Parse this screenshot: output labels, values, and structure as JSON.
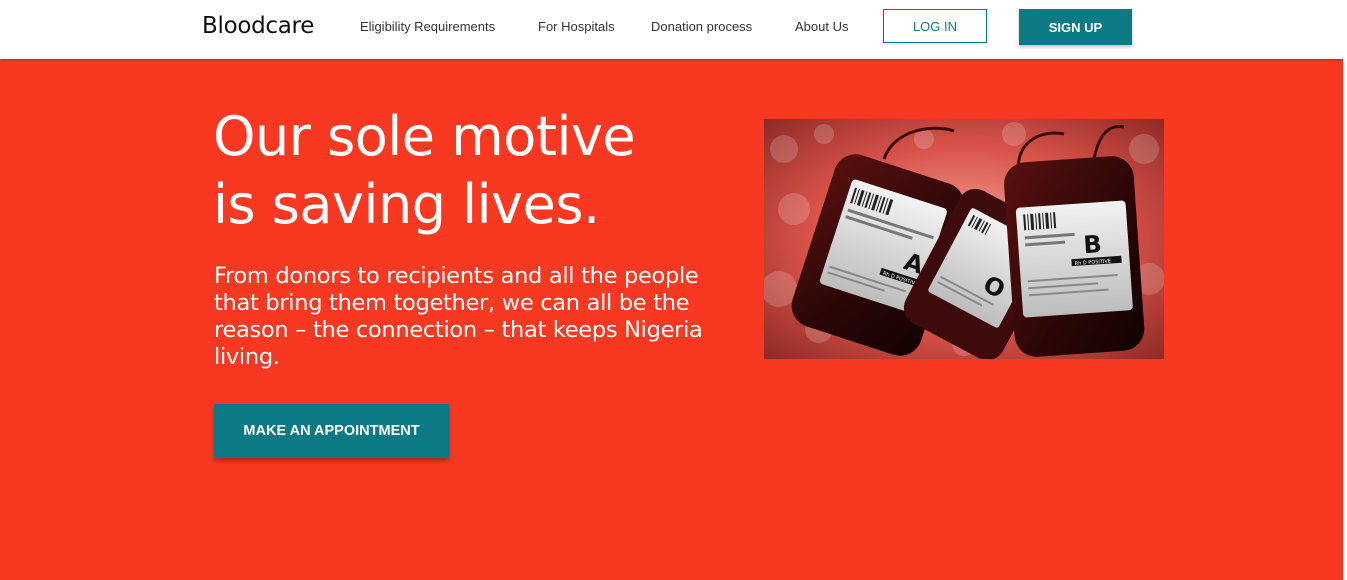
{
  "nav": {
    "logo": "Bloodcare",
    "links": [
      {
        "label": "Eligibility Requirements"
      },
      {
        "label": "For Hospitals"
      },
      {
        "label": "Donation process"
      },
      {
        "label": "About Us"
      }
    ],
    "login_label": "LOG IN",
    "signup_label": "SIGN UP"
  },
  "hero": {
    "headline_line1": "Our sole motive",
    "headline_line2": "is saving lives.",
    "subtext": "From donors to recipients and all the people that bring them together, we can all be the reason – the connection – that keeps Nigeria living.",
    "cta_label": "MAKE AN APPOINTMENT",
    "image": {
      "subject": "blood-bags-on-ice",
      "bag_labels": [
        "A",
        "O",
        "B"
      ],
      "bag_subtitle": "Rh D POSITIVE"
    }
  },
  "colors": {
    "hero_background": "#f93822",
    "accent_teal": "#0c7a85",
    "nav_background": "#ffffff",
    "text_on_hero": "#ffffff"
  }
}
